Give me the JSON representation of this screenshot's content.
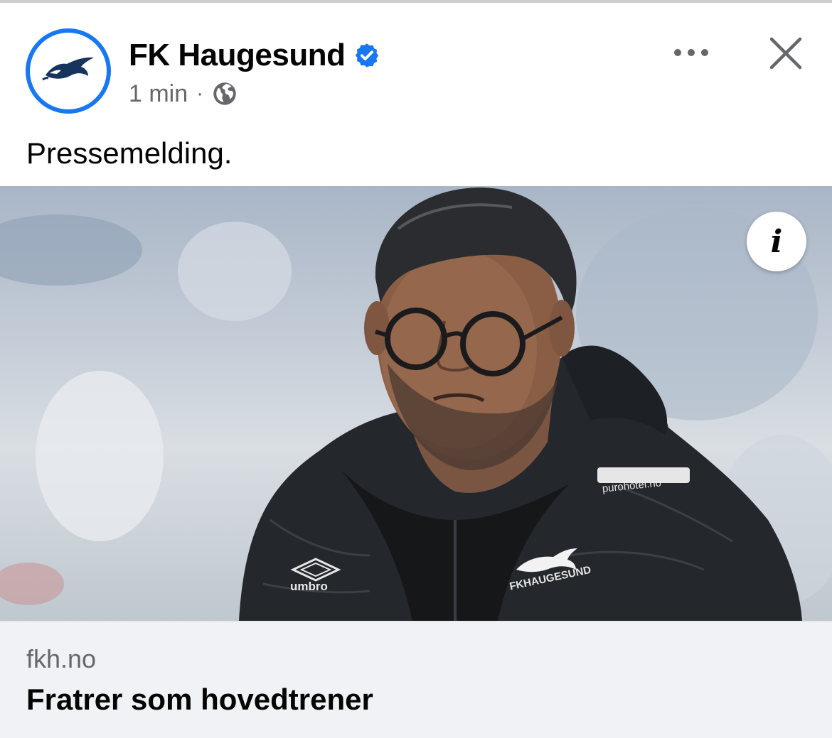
{
  "post": {
    "page_name": "FK Haugesund",
    "time": "1 min",
    "separator": "·",
    "privacy_icon": "globe-icon",
    "verified_icon": "verified-badge-icon",
    "text": "Pressemelding."
  },
  "actions": {
    "more_icon": "more-horizontal-icon",
    "close_icon": "close-icon",
    "info_icon": "info-icon",
    "info_glyph": "i"
  },
  "link_preview": {
    "domain": "fkh.no",
    "title": "Fratrer som hovedtrener"
  },
  "photo": {
    "jacket_texts": [
      "umbro",
      "FKHAUGESUND",
      "purohotel.no"
    ]
  },
  "colors": {
    "accent": "#1877f2",
    "text_primary": "#050505",
    "text_secondary": "#65676b",
    "card_background": "#f0f2f5",
    "crest_navy": "#16345e"
  }
}
